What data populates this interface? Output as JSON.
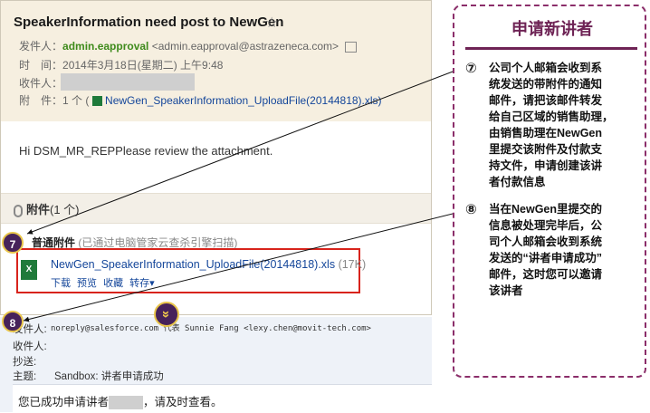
{
  "email1": {
    "subject": "SpeakerInformation need post to NewGen",
    "from_label": "发件人：",
    "from_name": "admin.eapproval",
    "from_addr": "<admin.eapproval@astrazeneca.com>",
    "time_label": "时　间：",
    "time_value": "2014年3月18日(星期二) 上午9:48",
    "to_label": "收件人：",
    "attach_label": "附　件：",
    "attach_count": "1 个 (",
    "attach_file": "NewGen_SpeakerInformation_UploadFile(20144818).xls)",
    "body": "Hi DSM_MR_REPPlease review the attachment.",
    "attachments_title": "附件",
    "attachments_count": "(1 个)",
    "normal_attach": "普通附件",
    "scan_note": "(已通过电脑管家云查杀引擎扫描)",
    "file_name": "NewGen_SpeakerInformation_UploadFile(20144818).xls",
    "file_size": "(17K)",
    "actions": "下载 预览 收藏 转存▾"
  },
  "email2": {
    "from_label": "发件人:",
    "from_value": "noreply@salesforce.com 代表 Sunnie Fang <lexy.chen@movit-tech.com>",
    "to_label": "收件人:",
    "cc_label": "抄送:",
    "subject_label": "主题:",
    "subject_value": "Sandbox: 讲者申请成功",
    "body_pre": "您已成功申请讲者",
    "body_post": "，请及时查看。"
  },
  "badges": {
    "seven": "7",
    "eight": "8",
    "expand": "»"
  },
  "panel": {
    "title": "申请新讲者",
    "step7_num": "⑦",
    "step7_lines": [
      "公司个人邮箱会收到系",
      "统发送的带附件的通知",
      "邮件，请把该邮件转发",
      "给自己区域的销售助理，",
      "由销售助理在NewGen",
      "里提交该附件及付款支",
      "持文件，申请创建该讲",
      "者付款信息"
    ],
    "step8_num": "⑧",
    "step8_lines": [
      "当在NewGen里提交的",
      "信息被处理完毕后，公",
      "司个人邮箱会收到系统",
      "发送的“讲者申请成功”",
      "邮件，这时您可以邀请",
      "该讲者"
    ]
  },
  "colors": {
    "accent": "#6e2355",
    "badge": "#46225a",
    "highlight": "#d8231c",
    "link": "#14469a"
  }
}
